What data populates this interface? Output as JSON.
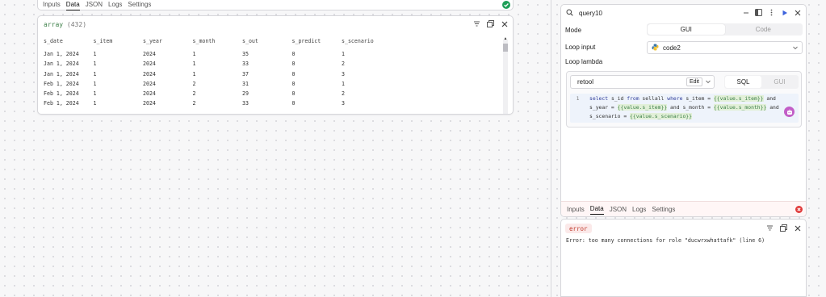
{
  "left_tabs": {
    "items": [
      "Inputs",
      "Data",
      "JSON",
      "Logs",
      "Settings"
    ],
    "active": "Data"
  },
  "data_card": {
    "type_label": "array",
    "count_label": "(432)",
    "columns": [
      "s_date",
      "s_item",
      "s_year",
      "s_month",
      "s_out",
      "s_predict",
      "s_scenario"
    ],
    "rows": [
      [
        "Jan 1, 2024",
        "1",
        "2024",
        "1",
        "35",
        "0",
        "1"
      ],
      [
        "Jan 1, 2024",
        "1",
        "2024",
        "1",
        "33",
        "0",
        "2"
      ],
      [
        "Jan 1, 2024",
        "1",
        "2024",
        "1",
        "37",
        "0",
        "3"
      ],
      [
        "Feb 1, 2024",
        "1",
        "2024",
        "2",
        "31",
        "0",
        "1"
      ],
      [
        "Feb 1, 2024",
        "1",
        "2024",
        "2",
        "29",
        "0",
        "2"
      ],
      [
        "Feb 1, 2024",
        "1",
        "2024",
        "2",
        "33",
        "0",
        "3"
      ]
    ]
  },
  "query_panel": {
    "title": "query10",
    "mode_label": "Mode",
    "mode_options": [
      "GUI",
      "Code"
    ],
    "mode_selected": "GUI",
    "loop_input_label": "Loop input",
    "loop_input_value": "code2",
    "loop_lambda_label": "Loop lambda",
    "resource": "retool",
    "edit_label": "Edit",
    "editor_modes": [
      "SQL",
      "GUI"
    ],
    "editor_mode_selected": "SQL",
    "line_number": "1",
    "sql": [
      {
        "t": "kw",
        "v": "select"
      },
      {
        "t": "plain",
        "v": " s_id "
      },
      {
        "t": "kw",
        "v": "from"
      },
      {
        "t": "plain",
        "v": " sellall "
      },
      {
        "t": "kw",
        "v": "where"
      },
      {
        "t": "plain",
        "v": " s_item = "
      },
      {
        "t": "tpl",
        "v": "{{value.s_item}}"
      },
      {
        "t": "plain",
        "v": " and s_year = "
      },
      {
        "t": "tpl",
        "v": "{{value.s_item}}"
      },
      {
        "t": "plain",
        "v": " and s_month = "
      },
      {
        "t": "tpl",
        "v": "{{value.s_month}}"
      },
      {
        "t": "plain",
        "v": " and s_scenario = "
      },
      {
        "t": "tpl",
        "v": "{{value.s_scenario}}"
      }
    ]
  },
  "bottom_tabs": {
    "items": [
      "Inputs",
      "Data",
      "JSON",
      "Logs",
      "Settings"
    ],
    "active": "Data"
  },
  "error_panel": {
    "badge": "error",
    "message": "Error: too many connections for role \"ducwrxwhattafk\" (line 6)"
  },
  "colors": {
    "success": "#1e9e57",
    "error": "#e03b3b",
    "accent": "#3d63dd",
    "template_green": "#3a7e46"
  }
}
